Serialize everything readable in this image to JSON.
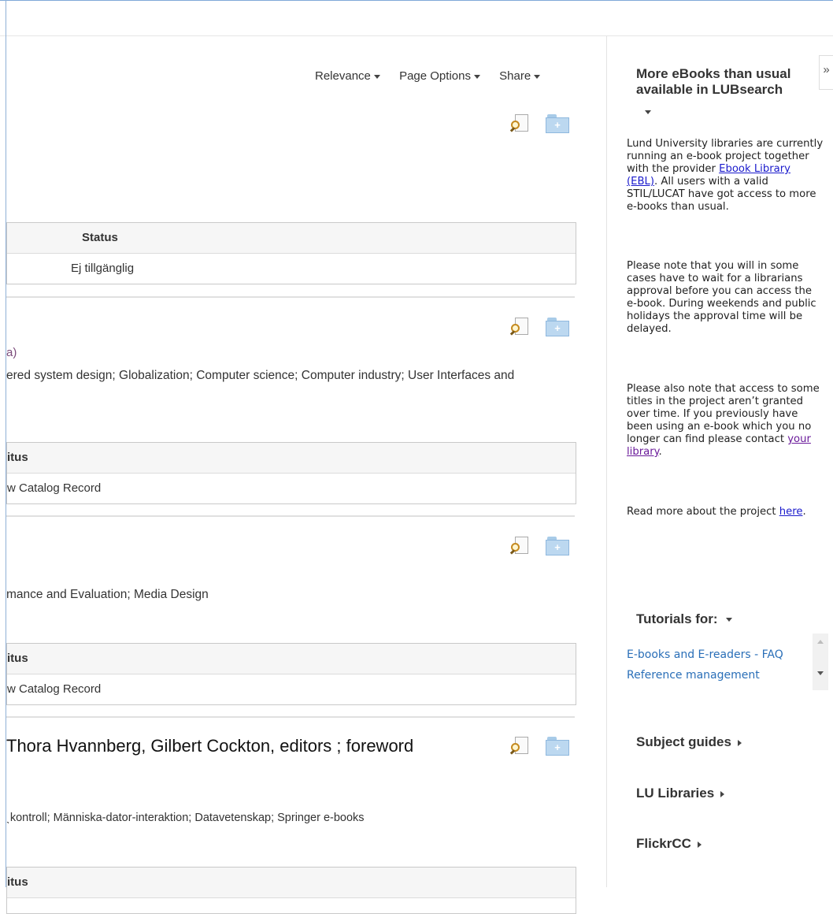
{
  "sort": {
    "relevance": "Relevance",
    "page_options": "Page Options",
    "share": "Share"
  },
  "records": [
    {
      "holdings_header": "Status",
      "holdings_value": "Ej tillgänglig"
    },
    {
      "frag": "a)",
      "subjects": "ered system design; Globalization; Computer science; Computer industry; User Interfaces and",
      "holdings_header": "itus",
      "holdings_value": "w Catalog Record"
    },
    {
      "subjects": "mance and Evaluation; Media Design",
      "holdings_header": "itus",
      "holdings_value": "w Catalog Record"
    },
    {
      "title": "Thora Hvannberg, Gilbert Cockton, editors ; foreword",
      "subjects": "ˎkontroll; Människa-dator-interaktion; Datavetenskap; Springer e-books",
      "holdings_header": "itus"
    }
  ],
  "sidebar": {
    "collapse": "»",
    "ebook_title": "More eBooks than usual available in LUBsearch",
    "p1_a": "Lund University libraries are currently running an e-book project together with the provider ",
    "p1_link": "Ebook Library (EBL)",
    "p1_b": ". All users with a valid STIL/LUCAT have got access to more e-books than usual.",
    "p2": "Please note that you will in some cases have to wait for a librarians approval before you can access the e-book. During weekends and public holidays the approval time will be delayed.",
    "p3_a": "Please also note that access to some titles in the project aren’t granted over time. If you previously have been using an e-book which you no longer can find please contact ",
    "p3_link": "your library",
    "p3_b": ".",
    "p4_a": "Read more about the project ",
    "p4_link": "here",
    "p4_b": ".",
    "tutorials_label": "Tutorials for:",
    "tutorials": [
      "E-books and E-readers - FAQ",
      "Reference management"
    ],
    "subject_guides": "Subject guides",
    "lu_libraries": "LU Libraries",
    "flickr": "FlickrCC"
  }
}
